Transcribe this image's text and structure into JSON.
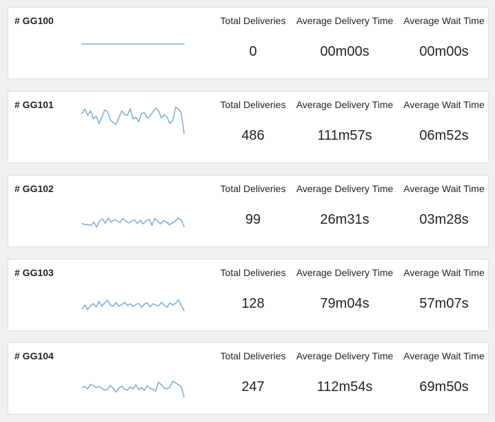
{
  "cards": [
    {
      "id": "# GG100",
      "trend": [
        50,
        50,
        50,
        50,
        50,
        50,
        50,
        50,
        50,
        50,
        50,
        50,
        50,
        50,
        50,
        50,
        50,
        50,
        50,
        50
      ],
      "stats": [
        {
          "label": "Total Deliveries",
          "value": "0"
        },
        {
          "label": "Average Delivery Time",
          "value": "00m00s"
        },
        {
          "label": "Average Wait Time",
          "value": "00m00s"
        }
      ]
    },
    {
      "id": "# GG101",
      "trend": [
        82,
        92,
        78,
        88,
        70,
        76,
        60,
        74,
        90,
        86,
        68,
        62,
        58,
        72,
        88,
        80,
        78,
        92,
        70,
        74,
        64,
        82,
        84,
        72,
        76,
        86,
        94,
        88,
        72,
        80,
        74,
        60,
        66,
        96,
        92,
        84,
        38
      ],
      "stats": [
        {
          "label": "Total Deliveries",
          "value": "486"
        },
        {
          "label": "Average Delivery Time",
          "value": "111m57s"
        },
        {
          "label": "Average Wait Time",
          "value": "06m52s"
        }
      ]
    },
    {
      "id": "# GG102",
      "trend": [
        25,
        22,
        23,
        20,
        28,
        17,
        30,
        35,
        25,
        37,
        28,
        33,
        31,
        27,
        36,
        30,
        26,
        30,
        33,
        25,
        32,
        24,
        31,
        34,
        21,
        36,
        29,
        24,
        31,
        28,
        22,
        26,
        30,
        37,
        33,
        18
      ],
      "stats": [
        {
          "label": "Total Deliveries",
          "value": "99"
        },
        {
          "label": "Average Delivery Time",
          "value": "26m31s"
        },
        {
          "label": "Average Wait Time",
          "value": "03m28s"
        }
      ]
    },
    {
      "id": "# GG103",
      "trend": [
        22,
        30,
        20,
        29,
        33,
        26,
        38,
        28,
        35,
        41,
        30,
        27,
        35,
        28,
        31,
        36,
        29,
        33,
        27,
        31,
        34,
        25,
        32,
        35,
        26,
        33,
        30,
        28,
        36,
        30,
        25,
        35,
        30,
        34,
        42,
        29,
        18
      ],
      "stats": [
        {
          "label": "Total Deliveries",
          "value": "128"
        },
        {
          "label": "Average Delivery Time",
          "value": "79m04s"
        },
        {
          "label": "Average Wait Time",
          "value": "57m07s"
        }
      ]
    },
    {
      "id": "# GG104",
      "trend": [
        32,
        34,
        29,
        39,
        36,
        32,
        34,
        30,
        26,
        28,
        36,
        30,
        22,
        31,
        35,
        28,
        26,
        34,
        29,
        38,
        27,
        32,
        26,
        36,
        30,
        28,
        24,
        44,
        38,
        31,
        29,
        33,
        46,
        42,
        38,
        34,
        11
      ],
      "stats": [
        {
          "label": "Total Deliveries",
          "value": "247"
        },
        {
          "label": "Average Delivery Time",
          "value": "112m54s"
        },
        {
          "label": "Average Wait Time",
          "value": "69m50s"
        }
      ]
    }
  ]
}
